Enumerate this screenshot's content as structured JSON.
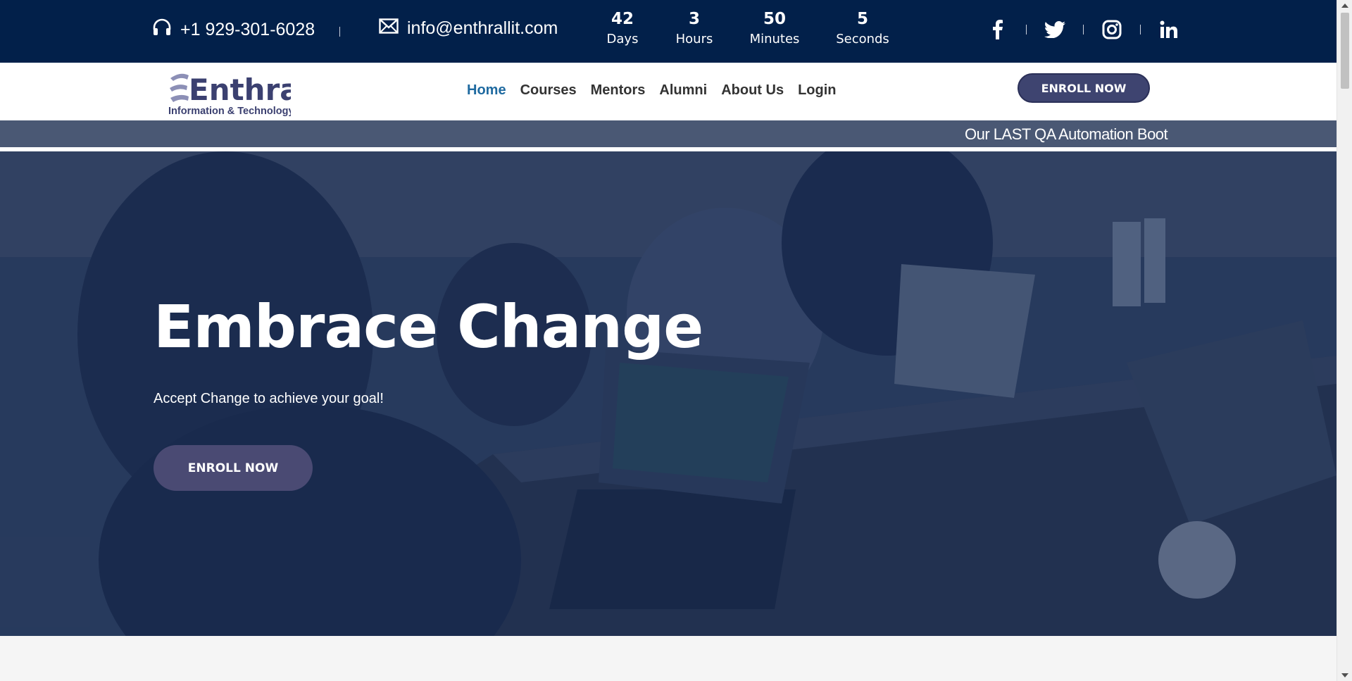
{
  "topbar": {
    "phone": "+1 929-301-6028",
    "email": "info@enthrallit.com",
    "countdown": [
      {
        "value": "42",
        "label": "Days"
      },
      {
        "value": "3",
        "label": "Hours"
      },
      {
        "value": "50",
        "label": "Minutes"
      },
      {
        "value": "5",
        "label": "Seconds"
      }
    ],
    "social": [
      "facebook-icon",
      "twitter-icon",
      "instagram-icon",
      "linkedin-icon"
    ]
  },
  "logo": {
    "name": "Enthrall",
    "tagline": "Information & Technology"
  },
  "nav": {
    "items": [
      "Home",
      "Courses",
      "Mentors",
      "Alumni",
      "About Us",
      "Login"
    ],
    "active": "Home",
    "enroll_label": "ENROLL NOW"
  },
  "ticker": {
    "text": "Our LAST QA Automation Boot"
  },
  "hero": {
    "title": "Embrace Change",
    "subtitle": "Accept Change to achieve your goal!",
    "button_label": "ENROLL NOW"
  },
  "colors": {
    "topbar_bg": "#02204a",
    "nav_active": "#1f6aa0",
    "button_bg": "#3e4470",
    "ticker_bg": "#4a5874"
  }
}
